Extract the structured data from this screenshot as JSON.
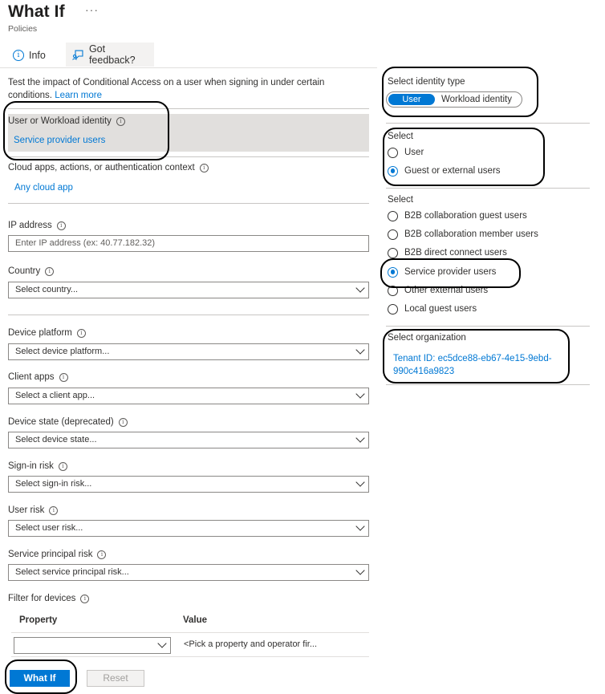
{
  "header": {
    "title": "What If",
    "more_label": "···",
    "subtitle": "Policies"
  },
  "tabs": [
    {
      "label": "Info",
      "icon": "info-icon"
    },
    {
      "label": "Got feedback?",
      "icon": "feedback-icon"
    }
  ],
  "description": {
    "text": "Test the impact of Conditional Access on a user when signing in under certain conditions.",
    "link": "Learn more"
  },
  "identity": {
    "label": "User or Workload identity",
    "value": "Service provider users"
  },
  "cloud_apps": {
    "label": "Cloud apps, actions, or authentication context",
    "value": "Any cloud app"
  },
  "ip_address": {
    "label": "IP address",
    "placeholder": "Enter IP address (ex: 40.77.182.32)"
  },
  "country": {
    "label": "Country",
    "value": "Select country..."
  },
  "device_platform": {
    "label": "Device platform",
    "value": "Select device platform..."
  },
  "client_apps": {
    "label": "Client apps",
    "value": "Select a client app..."
  },
  "device_state": {
    "label": "Device state (deprecated)",
    "value": "Select device state..."
  },
  "signin_risk": {
    "label": "Sign-in risk",
    "value": "Select sign-in risk..."
  },
  "user_risk": {
    "label": "User risk",
    "value": "Select user risk..."
  },
  "sp_risk": {
    "label": "Service principal risk",
    "value": "Select service principal risk..."
  },
  "filter_devices": {
    "label": "Filter for devices",
    "columns": [
      "Property",
      "Value"
    ],
    "property_value": "",
    "value_text": "<Pick a property and operator fir..."
  },
  "buttons": {
    "whatif": "What If",
    "reset": "Reset"
  },
  "identity_type": {
    "label": "Select identity type",
    "options": [
      "User",
      "Workload identity"
    ],
    "selected": "User"
  },
  "select_group": {
    "label": "Select",
    "options": [
      {
        "label": "User",
        "checked": false
      },
      {
        "label": "Guest or external users",
        "checked": true
      }
    ]
  },
  "select_guest": {
    "label": "Select",
    "options": [
      {
        "label": "B2B collaboration guest users",
        "checked": false
      },
      {
        "label": "B2B collaboration member users",
        "checked": false
      },
      {
        "label": "B2B direct connect users",
        "checked": false
      },
      {
        "label": "Service provider users",
        "checked": true
      },
      {
        "label": "Other external users",
        "checked": false
      },
      {
        "label": "Local guest users",
        "checked": false
      }
    ]
  },
  "organization": {
    "label": "Select organization",
    "value": "Tenant ID: ec5dce88-eb67-4e15-9ebd-990c416a9823"
  },
  "colors": {
    "accent": "#0078d4",
    "text": "#323130",
    "highlight": "#000000"
  }
}
